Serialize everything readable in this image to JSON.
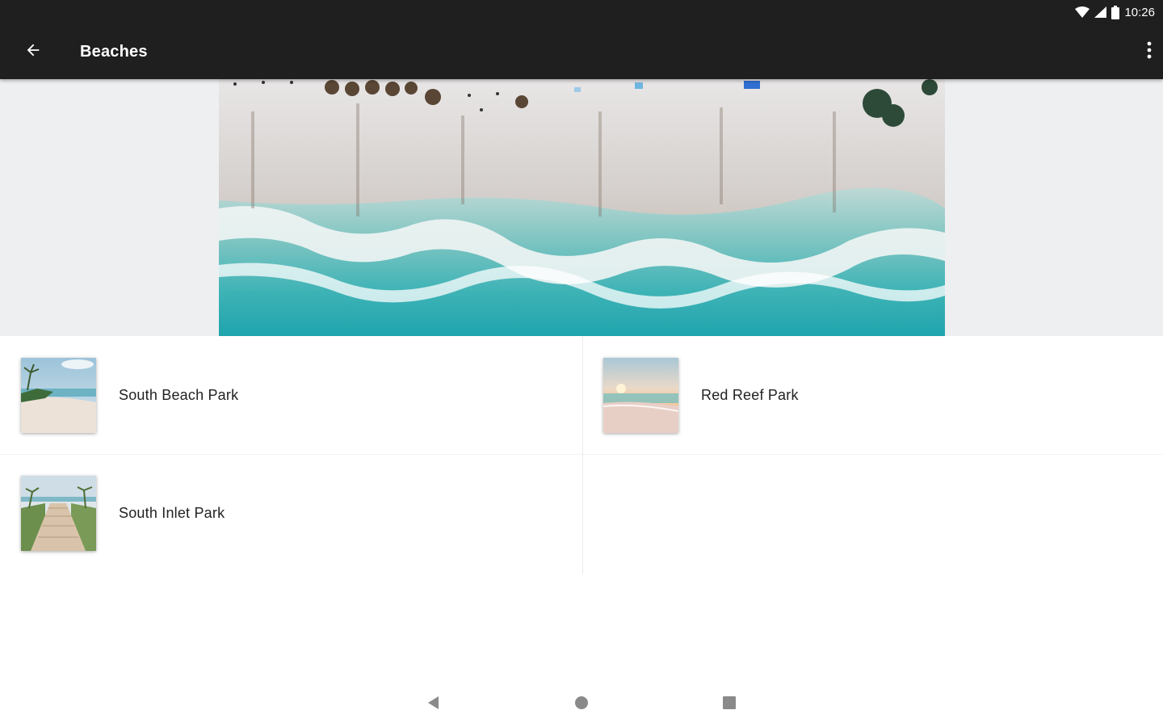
{
  "status_bar": {
    "time": "10:26",
    "icons": [
      "wifi-icon",
      "cell-signal-icon",
      "battery-icon"
    ]
  },
  "app_bar": {
    "title": "Beaches",
    "back_icon": "arrow-back-icon",
    "overflow_icon": "more-vert-icon",
    "background": "#1f1f1f"
  },
  "hero": {
    "image": "aerial-beach-photo"
  },
  "places": [
    {
      "name": "South Beach Park",
      "thumb": "beach-palm-photo"
    },
    {
      "name": "Red Reef Park",
      "thumb": "sunset-beach-photo"
    },
    {
      "name": "South Inlet Park",
      "thumb": "boardwalk-photo"
    }
  ],
  "nav_bar": {
    "icons": [
      "nav-back-icon",
      "nav-home-icon",
      "nav-recents-icon"
    ]
  }
}
